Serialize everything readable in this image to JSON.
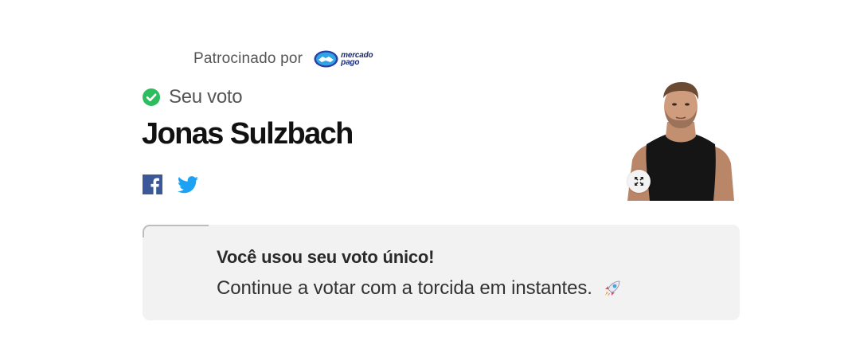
{
  "sponsor": {
    "label": "Patrocinado por",
    "logo_line1": "mercado",
    "logo_line2": "pago",
    "logo_icon": "handshake-icon"
  },
  "vote": {
    "label": "Seu voto",
    "icon": "check-circle-icon",
    "check_color": "#2dbd5f"
  },
  "candidate": {
    "name": "Jonas Sulzbach",
    "photo_icon": "person-photo",
    "expand_icon": "expand-icon"
  },
  "share": {
    "facebook_icon": "facebook-icon",
    "twitter_icon": "twitter-icon",
    "facebook_color": "#3b5998",
    "twitter_color": "#1da1f2"
  },
  "notice": {
    "title": "Você usou seu voto único!",
    "body": "Continue a votar com a torcida em instantes.",
    "icon": "rocket-icon",
    "background": "#f2f2f2"
  }
}
